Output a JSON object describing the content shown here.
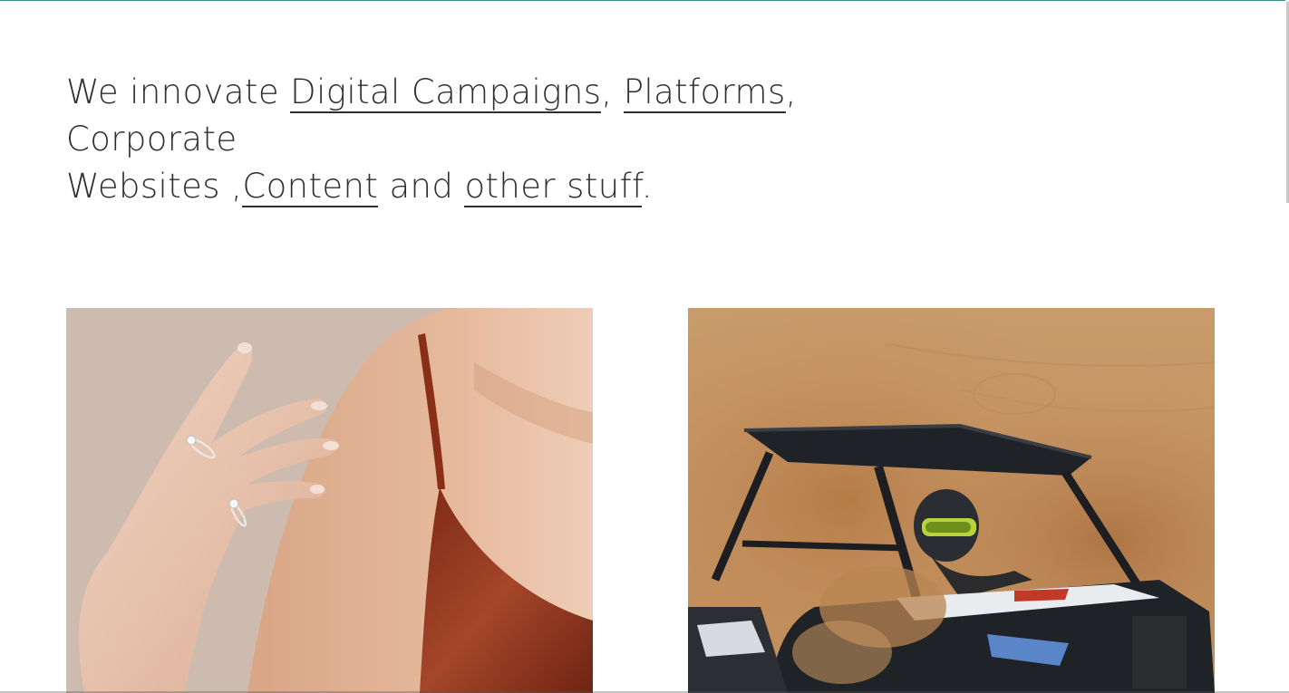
{
  "headline": {
    "intro": "We innovate",
    "link_1": "Digital Campaigns",
    "sep_1": ",",
    "link_2": "Platforms",
    "sep_2": ",",
    "plain_1": "Corporate",
    "plain_2": "Websites",
    "sep_3": ",",
    "link_3": "Content",
    "conj": "and",
    "link_4": "other stuff",
    "end": "."
  },
  "projects": [
    {
      "image": "jewelry-ring-hand-photo",
      "palette": {
        "bg": "#cfbdb0",
        "skin": "#e2b598",
        "fabric": "#9a3e22"
      }
    },
    {
      "image": "offroad-buggy-desert-photo",
      "palette": {
        "sand": "#c99a64",
        "dust": "#b78451",
        "vehicle": "#1f2226"
      }
    }
  ]
}
